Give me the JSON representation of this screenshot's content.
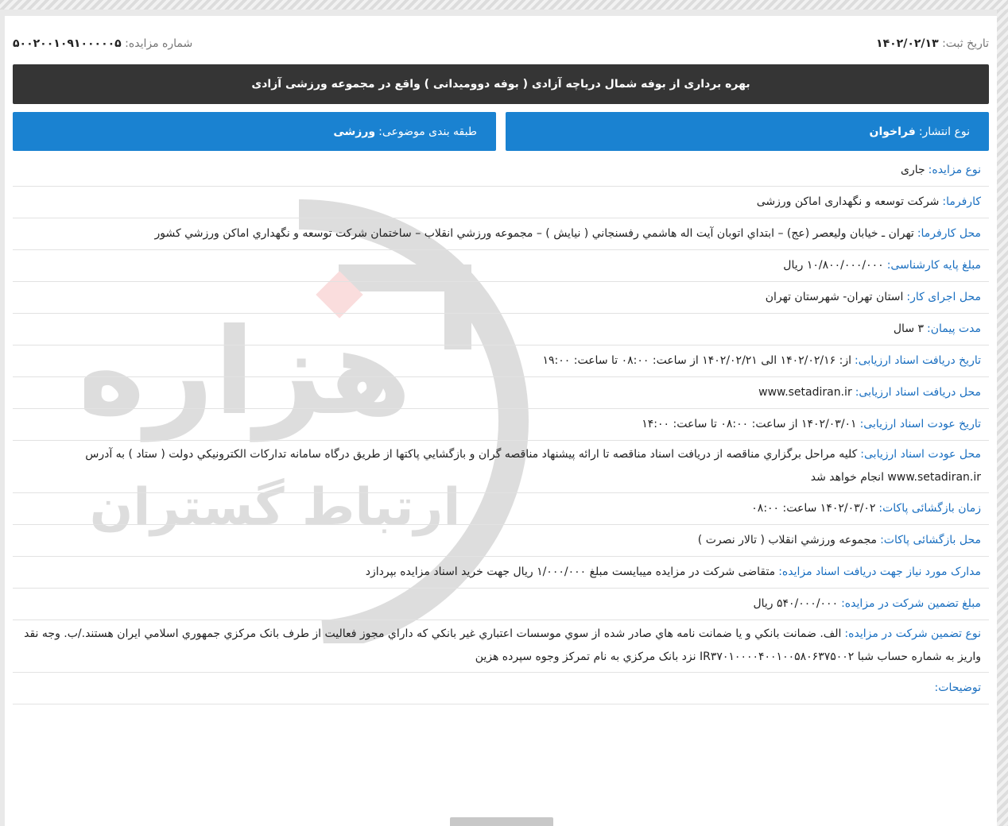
{
  "header": {
    "reg_date_label": "تاریخ ثبت:",
    "reg_date": "۱۴۰۲/۰۲/۱۳",
    "auction_no_label": "شماره مزایده:",
    "auction_no": "۵۰۰۲۰۰۱۰۹۱۰۰۰۰۰۵"
  },
  "title": "بهره برداری از بوفه شمال دریاچه آزادی ( بوفه دوومیدانی ) واقع در مجموعه ورزشی آزادی",
  "publish": {
    "label": "نوع انتشار:",
    "value": "فراخوان"
  },
  "category": {
    "label": "طبقه بندی موضوعی:",
    "value": "ورزشی"
  },
  "rows": [
    {
      "label": "نوع مزایده:",
      "value": "جاری"
    },
    {
      "label": "کارفرما:",
      "value": "شرکت توسعه و نگهداری اماکن ورزشی"
    },
    {
      "label": "محل کارفرما:",
      "value": "تهران ـ خیابان ولیعصر (عج) – ابتداي اتوبان آيت اله هاشمي رفسنجاني ( نيايش ) – مجموعه ورزشي انقلاب – ساختمان شرکت توسعه و نگهداري اماکن ورزشي کشور"
    },
    {
      "label": "مبلغ پایه کارشناسی:",
      "value": "۱۰/۸۰۰/۰۰۰/۰۰۰ ریال"
    },
    {
      "label": "محل اجرای کار:",
      "value": "استان تهران- شهرستان تهران"
    },
    {
      "label": "مدت پیمان:",
      "value": "۳ سال"
    },
    {
      "label": "تاریخ دریافت اسناد ارزیابی:",
      "value": "از: ۱۴۰۲/۰۲/۱۶ الی ۱۴۰۲/۰۲/۲۱ از ساعت: ۰۸:۰۰ تا ساعت: ۱۹:۰۰"
    },
    {
      "label": "محل دریافت اسناد ارزیابی:",
      "value": "www.setadiran.ir"
    },
    {
      "label": "تاریخ عودت اسناد ارزیابی:",
      "value": "۱۴۰۲/۰۳/۰۱ از ساعت: ۰۸:۰۰ تا ساعت: ۱۴:۰۰"
    },
    {
      "label": "محل عودت اسناد ارزیابی:",
      "value": "کلیه مراحل برگزاري مناقصه از دريافت اسناد مناقصه تا ارائه پيشنهاد مناقصه گران و بازگشايي پاکتها از طريق درگاه سامانه تدارکات الکترونيکي دولت ( ستاد ) به آدرس www.setadiran.ir انجام خواهد شد",
      "tall": true
    },
    {
      "label": "زمان بازگشائی پاکات:",
      "value": "۱۴۰۲/۰۳/۰۲ ساعت: ۰۸:۰۰"
    },
    {
      "label": "محل بازگشائی پاکات:",
      "value": "مجموعه ورزشي انقلاب ( تالار نصرت )"
    },
    {
      "label": "مدارک مورد نیاز جهت دریافت اسناد مزایده:",
      "value": "متقاضی شرکت در مزایده میبایست مبلغ ۱/۰۰۰/۰۰۰ ریال جهت خرید اسناد مزایده بپردازد"
    },
    {
      "label": "مبلغ تضمین شرکت در مزایده:",
      "value": "۵۴۰/۰۰۰/۰۰۰ ریال"
    },
    {
      "label": "نوع تضمین شرکت در مزایده:",
      "value": "الف. ضمانت بانکي و يا ضمانت نامه هاي صادر شده از سوي موسسات اعتباري غير بانکي که داراي مجوز فعاليت از طرف بانک مرکزي جمهوري اسلامي ايران هستند./ب. وجه نقد واريز به شماره حساب شبا IR۳۷۰۱۰۰۰۰۴۰۰۱۰۰۵۸۰۶۳۷۵۰۰۲ نزد بانک مرکزي به نام تمرکز وجوه سپرده هزين",
      "tall": true
    },
    {
      "label": "توضیحات:",
      "value": ""
    }
  ],
  "watermark": {
    "line1": "هزاره",
    "line2": "ارتباط گستران",
    "accent": "#f2a6a6"
  },
  "colors": {
    "title_bg": "#353535",
    "box_bg": "#1a82d1",
    "label": "#1a6fc0"
  }
}
